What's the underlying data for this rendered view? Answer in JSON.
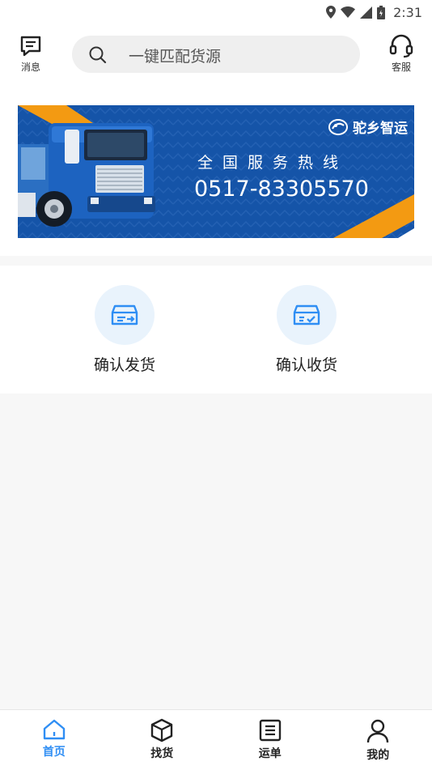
{
  "status_bar": {
    "time": "2:31"
  },
  "header": {
    "messages_label": "消息",
    "search_placeholder": "一键匹配货源",
    "service_label": "客服"
  },
  "banner": {
    "brand": "驼乡智运",
    "hotline_title": "全国服务热线",
    "hotline_number": "0517-83305570"
  },
  "actions": [
    {
      "label": "确认发货",
      "icon": "shipment-box-icon"
    },
    {
      "label": "确认收货",
      "icon": "receive-box-icon"
    }
  ],
  "bottom_nav": [
    {
      "label": "首页",
      "icon": "home-icon",
      "active": true
    },
    {
      "label": "找货",
      "icon": "package-icon",
      "active": false
    },
    {
      "label": "运单",
      "icon": "waybill-icon",
      "active": false
    },
    {
      "label": "我的",
      "icon": "user-icon",
      "active": false
    }
  ],
  "colors": {
    "accent": "#2f8ef4",
    "banner_blue": "#1554a8",
    "banner_orange": "#f39a12"
  }
}
